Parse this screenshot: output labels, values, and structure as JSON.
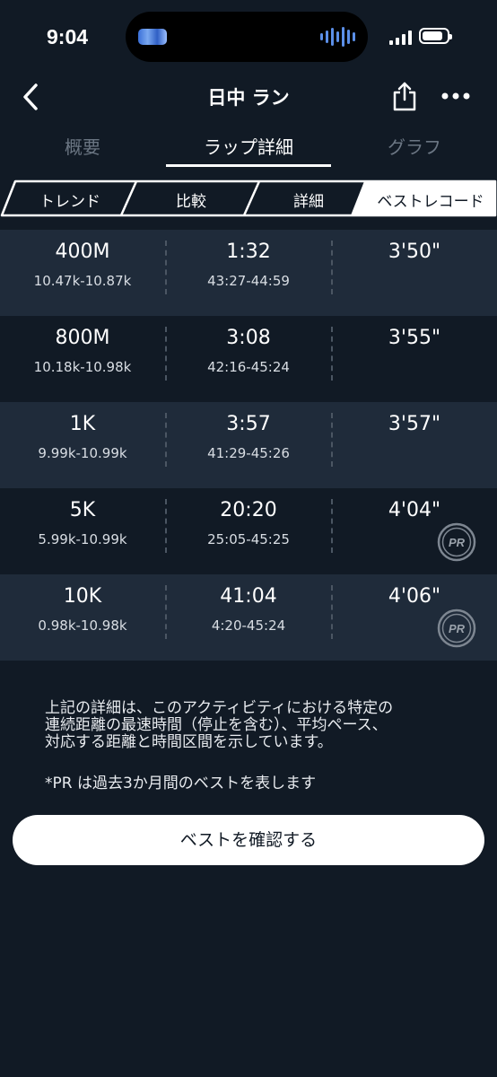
{
  "status": {
    "time": "9:04",
    "battery_level": 0.85
  },
  "nav": {
    "title": "日中 ラン"
  },
  "tabs": [
    {
      "label": "概要",
      "active": false
    },
    {
      "label": "ラップ詳細",
      "active": true
    },
    {
      "label": "グラフ",
      "active": false
    }
  ],
  "segments": [
    {
      "label": "トレンド",
      "active": false
    },
    {
      "label": "比較",
      "active": false
    },
    {
      "label": "詳細",
      "active": false
    },
    {
      "label": "ベストレコード",
      "active": true
    }
  ],
  "records": [
    {
      "distance": "400M",
      "range": "10.47k-10.87k",
      "time": "1:32",
      "time_range": "43:27-44:59",
      "pace": "3'50\"",
      "pr": false
    },
    {
      "distance": "800M",
      "range": "10.18k-10.98k",
      "time": "3:08",
      "time_range": "42:16-45:24",
      "pace": "3'55\"",
      "pr": false
    },
    {
      "distance": "1K",
      "range": "9.99k-10.99k",
      "time": "3:57",
      "time_range": "41:29-45:26",
      "pace": "3'57\"",
      "pr": false
    },
    {
      "distance": "5K",
      "range": "5.99k-10.99k",
      "time": "20:20",
      "time_range": "25:05-45:25",
      "pace": "4'04\"",
      "pr": true
    },
    {
      "distance": "10K",
      "range": "0.98k-10.98k",
      "time": "41:04",
      "time_range": "4:20-45:24",
      "pace": "4'06\"",
      "pr": true
    }
  ],
  "pr_badge": "PR",
  "note": {
    "line1": "上記の詳細は、このアクティビティにおける特定の",
    "line2": "連続距離の最速時間（停止を含む）、平均ペース、",
    "line3": "対応する距離と時間区間を示しています。",
    "pr_note": "*PR は過去3か月間のベストを表します"
  },
  "cta": {
    "label": "ベストを確認する"
  },
  "colors": {
    "background": "#111a25",
    "row_alt": "#1f2b3a",
    "text": "#ffffff",
    "muted": "#6b7683"
  }
}
